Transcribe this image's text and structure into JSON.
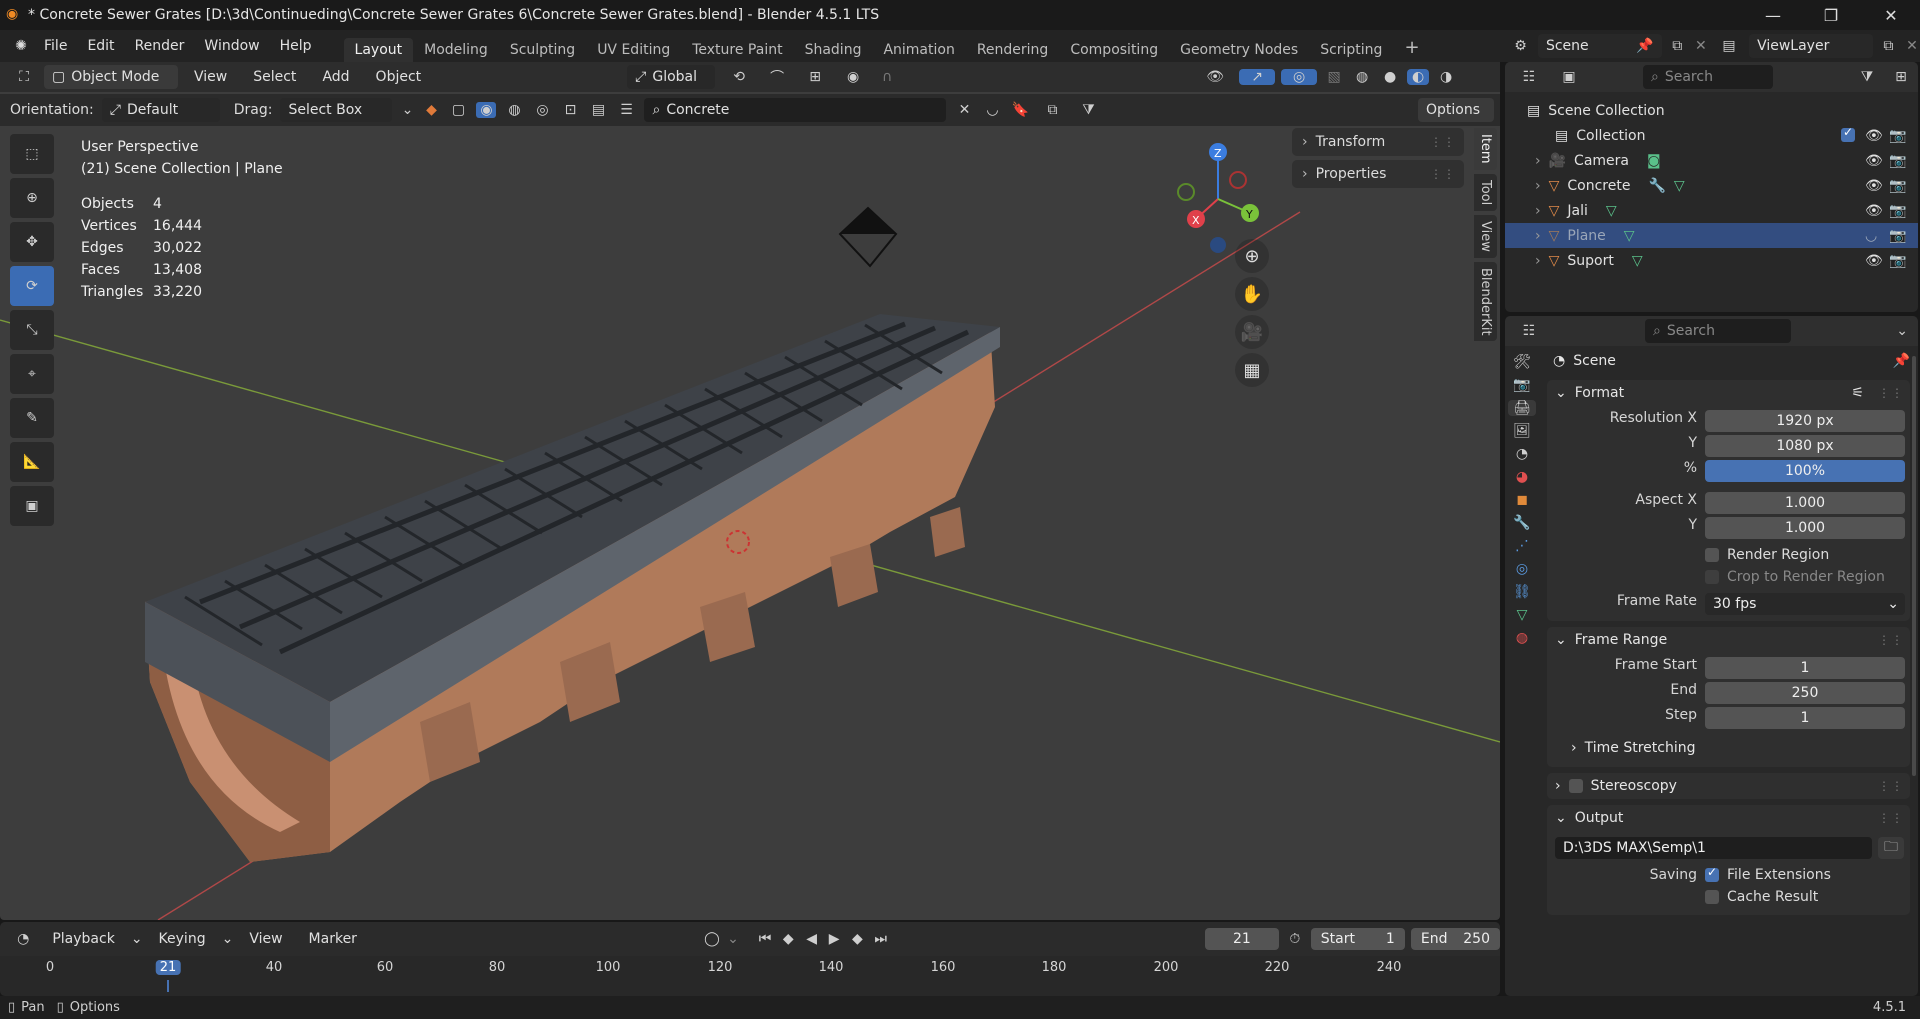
{
  "window": {
    "title": "* Concrete Sewer Grates [D:\\3d\\Continueding\\Concrete Sewer Grates 6\\Concrete Sewer Grates.blend] - Blender 4.5.1 LTS"
  },
  "menu": [
    "File",
    "Edit",
    "Render",
    "Window",
    "Help"
  ],
  "workspaces": [
    "Layout",
    "Modeling",
    "Sculpting",
    "UV Editing",
    "Texture Paint",
    "Shading",
    "Animation",
    "Rendering",
    "Compositing",
    "Geometry Nodes",
    "Scripting"
  ],
  "active_workspace": "Layout",
  "scene_selector": {
    "scene": "Scene",
    "view_layer": "ViewLayer"
  },
  "viewport_header": {
    "mode": "Object Mode",
    "menus": [
      "View",
      "Select",
      "Add",
      "Object"
    ],
    "transform_orientation": "Global"
  },
  "tool_header": {
    "orientation_label": "Orientation:",
    "orientation_value": "Default",
    "drag_label": "Drag:",
    "drag_value": "Select Box",
    "search_value": "Concrete",
    "options_label": "Options"
  },
  "viewport": {
    "perspective": "User Perspective",
    "context": "(21) Scene Collection | Plane",
    "stats": [
      {
        "label": "Objects",
        "value": "4"
      },
      {
        "label": "Vertices",
        "value": "16,444"
      },
      {
        "label": "Edges",
        "value": "30,022"
      },
      {
        "label": "Faces",
        "value": "13,408"
      },
      {
        "label": "Triangles",
        "value": "33,220"
      }
    ],
    "axis_labels": {
      "x": "X",
      "y": "Y",
      "z": "Z"
    }
  },
  "n_panel": {
    "sections": [
      "Transform",
      "Properties"
    ],
    "tabs": [
      "Item",
      "Tool",
      "View",
      "BlenderKit"
    ]
  },
  "outliner": {
    "search_placeholder": "Search",
    "root": "Scene Collection",
    "items": [
      {
        "name": "Collection"
      },
      {
        "name": "Camera"
      },
      {
        "name": "Concrete"
      },
      {
        "name": "Jali"
      },
      {
        "name": "Plane"
      },
      {
        "name": "Suport"
      }
    ]
  },
  "properties": {
    "search_placeholder": "Search",
    "context": "Scene",
    "format": {
      "title": "Format",
      "resolution_x_label": "Resolution X",
      "resolution_x": "1920 px",
      "resolution_y_label": "Y",
      "resolution_y": "1080 px",
      "percent_label": "%",
      "percent": "100%",
      "aspect_x_label": "Aspect X",
      "aspect_x": "1.000",
      "aspect_y_label": "Y",
      "aspect_y": "1.000",
      "render_region": "Render Region",
      "crop_region": "Crop to Render Region",
      "frame_rate_label": "Frame Rate",
      "frame_rate": "30 fps"
    },
    "frame_range": {
      "title": "Frame Range",
      "start_label": "Frame Start",
      "start": "1",
      "end_label": "End",
      "end": "250",
      "step_label": "Step",
      "step": "1",
      "time_stretching": "Time Stretching"
    },
    "stereoscopy": "Stereoscopy",
    "output": {
      "title": "Output",
      "path": "D:\\3DS MAX\\Semp\\1",
      "saving_label": "Saving",
      "file_extensions": "File Extensions",
      "cache_result": "Cache Result"
    }
  },
  "timeline": {
    "menus": [
      "Playback",
      "Keying",
      "View",
      "Marker"
    ],
    "current_frame": "21",
    "start_label": "Start",
    "start": "1",
    "end_label": "End",
    "end": "250",
    "ruler": [
      "0",
      "21",
      "40",
      "60",
      "80",
      "100",
      "120",
      "140",
      "160",
      "180",
      "200",
      "220",
      "240"
    ]
  },
  "status_bar": {
    "pan": "Pan",
    "options": "Options",
    "version": "4.5.1"
  }
}
